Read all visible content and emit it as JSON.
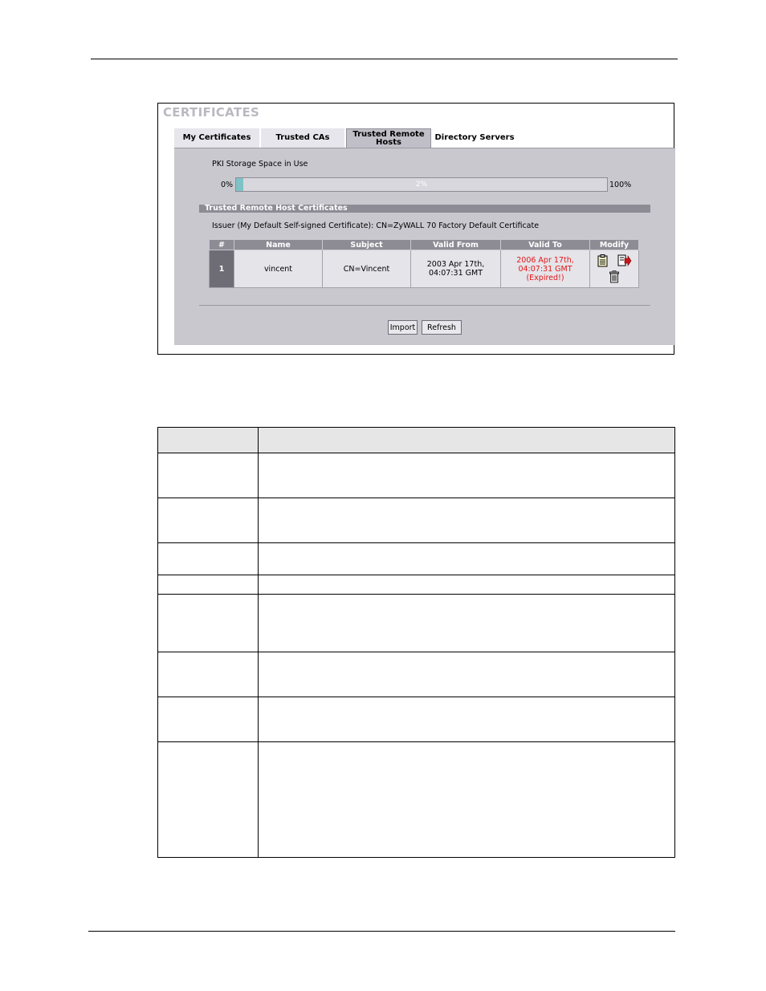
{
  "screenshot": {
    "title": "CERTIFICATES",
    "tabs": [
      {
        "label": "My Certificates",
        "active": false
      },
      {
        "label": "Trusted CAs",
        "active": false
      },
      {
        "label": "Trusted Remote Hosts",
        "active": true
      },
      {
        "label": "Directory Servers",
        "active": false
      }
    ],
    "pki": {
      "label": "PKI Storage Space in Use",
      "min_label": "0%",
      "max_label": "100%",
      "value_text": "2%",
      "value_fraction": 0.02
    },
    "section_title": "Trusted Remote Host Certificates",
    "issuer": "Issuer (My Default Self-signed Certificate): CN=ZyWALL 70 Factory Default Certificate",
    "table": {
      "headers": [
        "#",
        "Name",
        "Subject",
        "Valid From",
        "Valid To",
        "Modify"
      ],
      "rows": [
        {
          "index": "1",
          "name": "vincent",
          "subject": "CN=Vincent",
          "valid_from_1": "2003 Apr 17th,",
          "valid_from_2": "04:07:31 GMT",
          "valid_to_1": "2006 Apr 17th,",
          "valid_to_2": "04:07:31 GMT",
          "valid_to_3": "(Expired!)",
          "icons": [
            "details-icon",
            "export-icon",
            "delete-icon"
          ]
        }
      ]
    },
    "buttons": {
      "import": "Import",
      "refresh": "Refresh"
    },
    "colors": {
      "expired": "#e01818",
      "header": "#8d8c95",
      "panel": "#c9c8cf",
      "progress": "#7ec2c6"
    }
  },
  "desc_table_rows": 9
}
